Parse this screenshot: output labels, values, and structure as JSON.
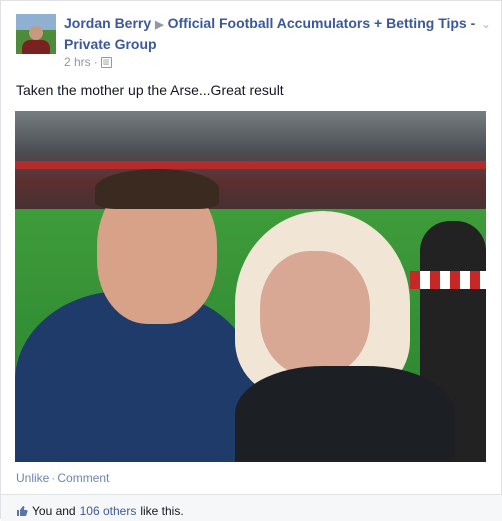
{
  "post": {
    "author": "Jordan Berry",
    "group": "Official Football Accumulators + Betting Tips - Private Group",
    "time": "2 hrs",
    "message": "Taken the mother up the Arse...Great result"
  },
  "actions": {
    "unlike": "Unlike",
    "comment": "Comment",
    "separator": "·"
  },
  "likes": {
    "prefix": "You and ",
    "others_link": "106 others",
    "suffix": " like this."
  },
  "icons": {
    "privacy": "members-icon",
    "thumb": "thumbs-up-icon",
    "arrow": "triangle-right-icon"
  }
}
